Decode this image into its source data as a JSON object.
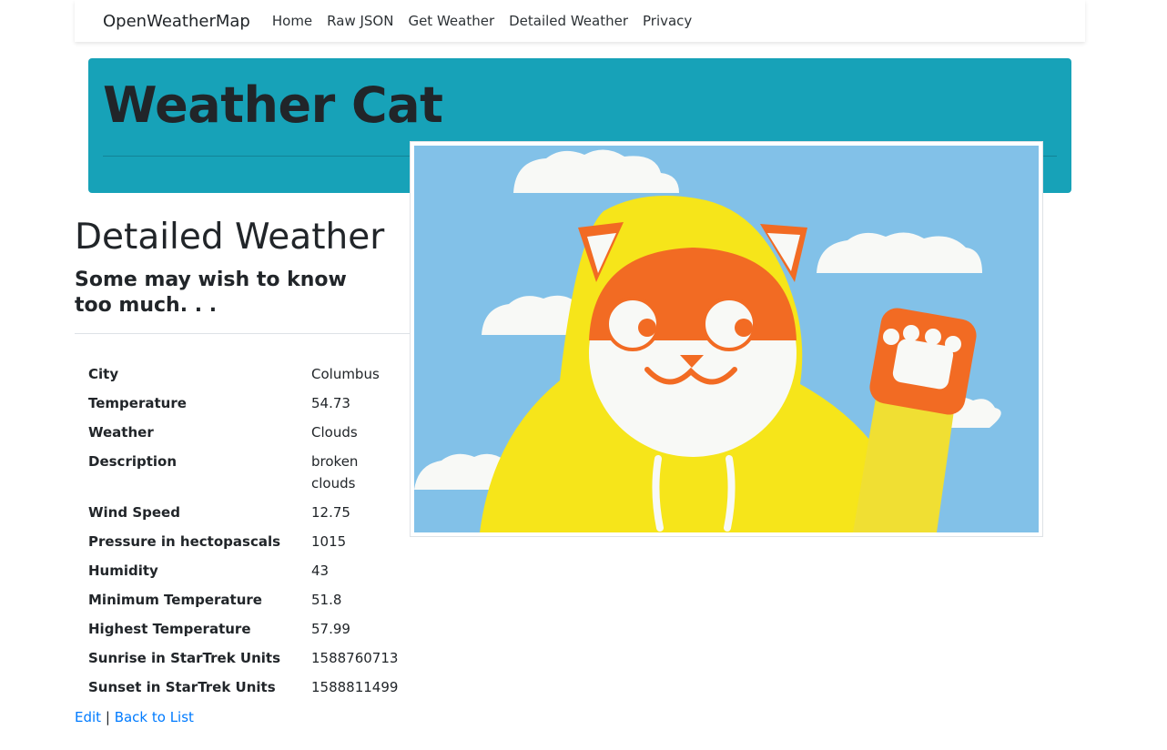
{
  "navbar": {
    "brand": "OpenWeatherMap",
    "items": [
      {
        "label": "Home"
      },
      {
        "label": "Raw JSON"
      },
      {
        "label": "Get Weather"
      },
      {
        "label": "Detailed Weather"
      },
      {
        "label": "Privacy"
      }
    ]
  },
  "jumbotron": {
    "title": "Weather Cat",
    "background": "#17a2b8"
  },
  "page": {
    "title": "Detailed Weather",
    "subtitle": "Some may wish to know too much. . ."
  },
  "details": [
    {
      "label": "City",
      "value": "Columbus"
    },
    {
      "label": "Temperature",
      "value": "54.73"
    },
    {
      "label": "Weather",
      "value": "Clouds"
    },
    {
      "label": "Description",
      "value": "broken clouds"
    },
    {
      "label": "Wind Speed",
      "value": "12.75"
    },
    {
      "label": "Pressure in hectopascals",
      "value": "1015"
    },
    {
      "label": "Humidity",
      "value": "43"
    },
    {
      "label": "Minimum Temperature",
      "value": "51.8"
    },
    {
      "label": "Highest Temperature",
      "value": "57.99"
    },
    {
      "label": "Sunrise in StarTrek Units",
      "value": "1588760713"
    },
    {
      "label": "Sunset in StarTrek Units",
      "value": "1588811499"
    }
  ],
  "links": {
    "edit": "Edit",
    "separator": "|",
    "back": "Back to List"
  },
  "image": {
    "icon": "weather-cat-illustration",
    "colors": {
      "sky": "#82c1e8",
      "hood": "#f6e51a",
      "fur": "#f26b23"
    }
  }
}
